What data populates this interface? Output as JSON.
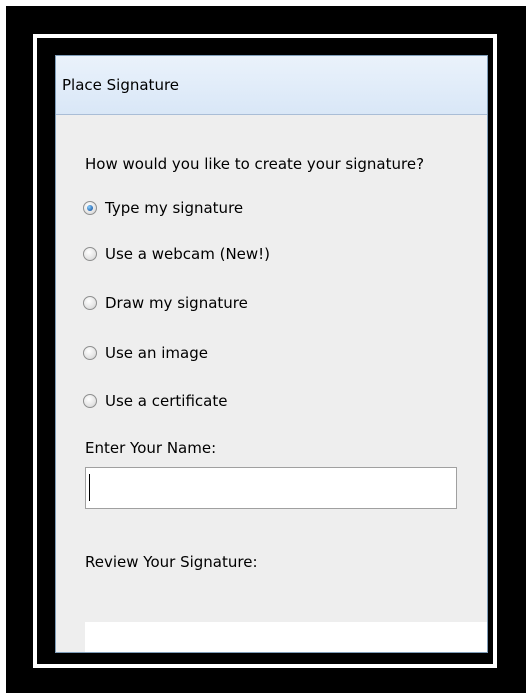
{
  "dialog": {
    "title": "Place Signature",
    "prompt": "How would you like to create your signature?",
    "options": [
      {
        "label": "Type my signature",
        "selected": true
      },
      {
        "label": "Use a webcam (New!)",
        "selected": false
      },
      {
        "label": "Draw my signature",
        "selected": false
      },
      {
        "label": "Use an image",
        "selected": false
      },
      {
        "label": "Use a certificate",
        "selected": false
      }
    ],
    "name_field": {
      "label": "Enter Your Name:",
      "value": ""
    },
    "review_label": "Review Your Signature:"
  }
}
